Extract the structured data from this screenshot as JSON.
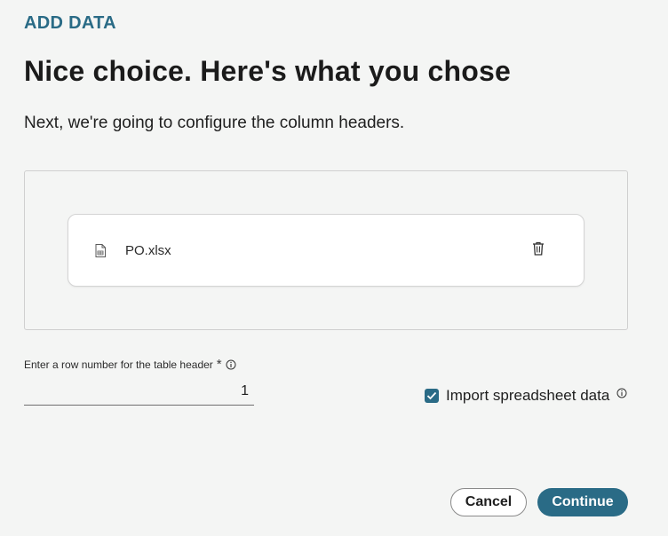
{
  "header": {
    "eyebrow": "ADD DATA",
    "title": "Nice choice. Here's what you chose",
    "subtitle": "Next, we're going to configure the column headers."
  },
  "upload": {
    "file": {
      "name": "PO.xlsx",
      "icon": "spreadsheet-file-icon",
      "action_icon": "trash-icon"
    }
  },
  "form": {
    "row_label": "Enter a row number for the table header",
    "required_marker": "*",
    "row_value": "1",
    "import_checkbox_label": "Import spreadsheet data",
    "import_checked": true
  },
  "actions": {
    "cancel": "Cancel",
    "continue": "Continue"
  },
  "colors": {
    "accent": "#2a6b86",
    "background": "#f4f5f4"
  }
}
